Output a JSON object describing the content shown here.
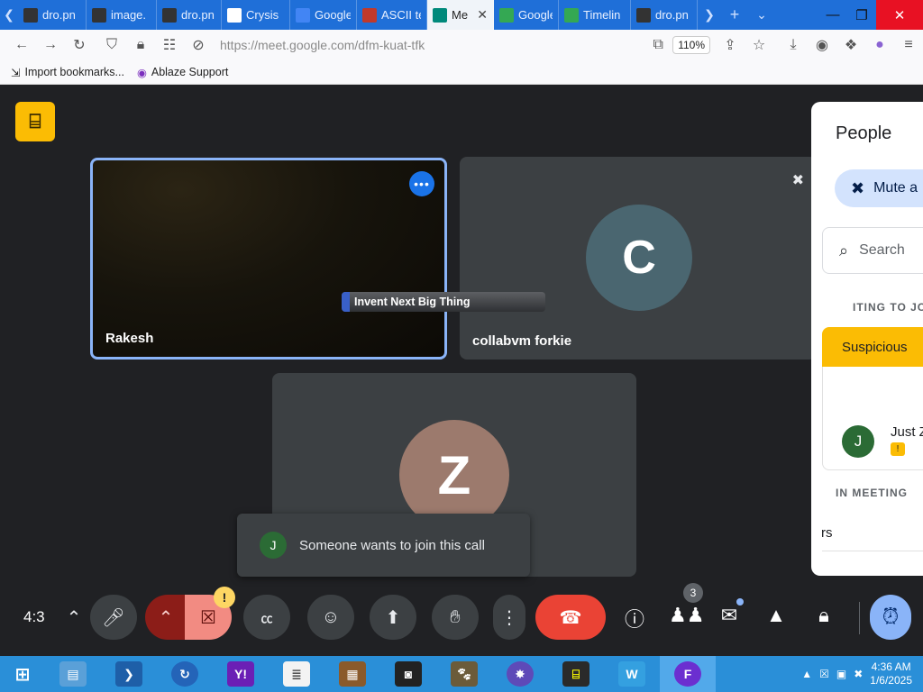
{
  "browser": {
    "tabs": [
      {
        "label": "dro.pn",
        "icon": "terminal-icon",
        "color": "#333333",
        "active": false
      },
      {
        "label": "image.",
        "icon": "terminal-icon",
        "color": "#333333",
        "active": false
      },
      {
        "label": "dro.pn",
        "icon": "terminal-icon",
        "color": "#333333",
        "active": false
      },
      {
        "label": "Crysis",
        "icon": "wikipedia-icon",
        "color": "#ffffff",
        "active": false
      },
      {
        "label": "Google",
        "icon": "google-translate-icon",
        "color": "#4285f4",
        "active": false
      },
      {
        "label": "ASCII te",
        "icon": "r-icon",
        "color": "#c0392b",
        "active": false
      },
      {
        "label": "Me",
        "icon": "meet-icon",
        "color": "#00897b",
        "active": true
      },
      {
        "label": "Google",
        "icon": "maps-pin-icon",
        "color": "#34a853",
        "active": false
      },
      {
        "label": "Timelin",
        "icon": "maps-pin-icon",
        "color": "#34a853",
        "active": false
      },
      {
        "label": "dro.pn",
        "icon": "terminal-icon",
        "color": "#333333",
        "active": false
      }
    ],
    "url_host": "https://meet.google.com",
    "url_path": "/dfm-kuat-tfk",
    "zoom": "110%",
    "bookmarks": [
      {
        "label": "Import bookmarks...",
        "icon": "import-icon"
      },
      {
        "label": "Ablaze Support",
        "icon": "ablaze-icon"
      }
    ]
  },
  "meet": {
    "tiles": [
      {
        "name": "Rakesh"
      },
      {
        "name": "collabvm forkie",
        "initial": "C"
      },
      {
        "initial": "Z"
      }
    ],
    "overlay_text": "Invent Next Big Thing",
    "toast": {
      "initial": "J",
      "text": "Someone wants to join this call"
    },
    "people_panel": {
      "title": "People",
      "mute_all": "Mute a",
      "search_placeholder": "Search",
      "waiting_label": "ITING TO JO",
      "suspicious_label": "Suspicious",
      "waiting_person": {
        "initial": "J",
        "name": "Just Z"
      },
      "in_meeting_label": "IN MEETING",
      "others_fragment": "rs"
    },
    "controls": {
      "clock": "4:3",
      "participant_count": "3",
      "camera_warning": "!"
    }
  },
  "taskbar": {
    "time": "4:36 AM",
    "date": "1/6/2025"
  },
  "colors": {
    "accent": "#1a73e8",
    "end_call": "#ea4335",
    "warning": "#fbbc04"
  }
}
